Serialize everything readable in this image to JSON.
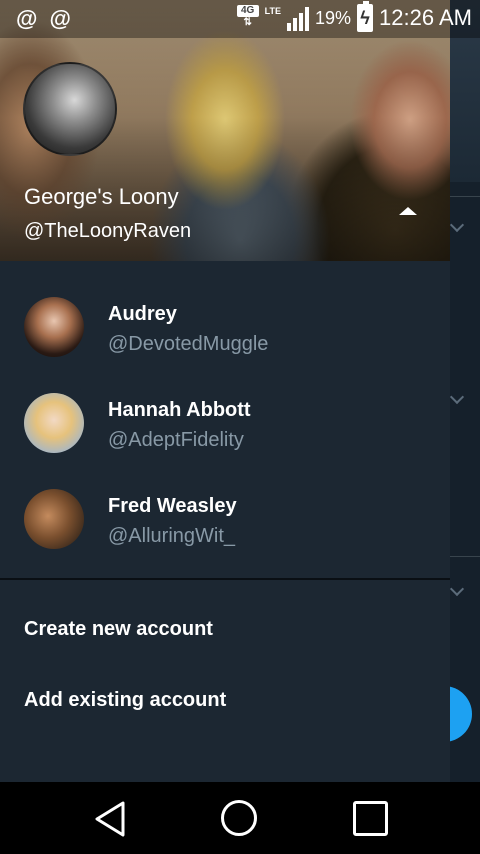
{
  "status_bar": {
    "left_icons": [
      "@",
      "@"
    ],
    "network_type": "4G",
    "network_sub": "LTE",
    "battery_percent": "19%",
    "time": "12:26 AM"
  },
  "profile": {
    "name": "George's Loony",
    "handle": "@TheLoonyRaven"
  },
  "accounts": [
    {
      "name": "Audrey",
      "handle": "@DevotedMuggle"
    },
    {
      "name": "Hannah Abbott",
      "handle": "@AdeptFidelity"
    },
    {
      "name": "Fred Weasley",
      "handle": "@AlluringWit_"
    }
  ],
  "actions": {
    "create": "Create new account",
    "add_existing": "Add existing account"
  },
  "colors": {
    "drawer_bg": "#1c2732",
    "handle_gray": "#8899a6",
    "accent": "#1da1f2"
  }
}
